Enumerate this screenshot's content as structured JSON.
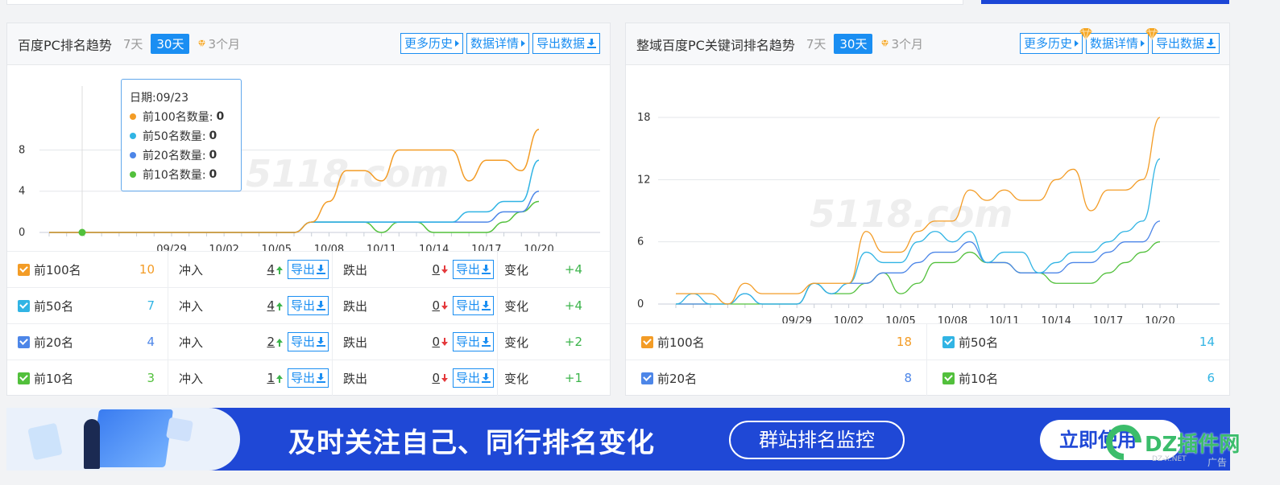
{
  "colors": {
    "accent": "#1a8ef2",
    "top100": "#f39c26",
    "top50": "#31b4e4",
    "top20": "#4d86e8",
    "top10": "#52c03c",
    "up": "#3cb44b",
    "down": "#e4393c"
  },
  "left_panel": {
    "title": "百度PC排名趋势",
    "ranges": [
      "7天",
      "30天",
      "3个月"
    ],
    "active_range": "30天",
    "buttons": {
      "history": "更多历史",
      "detail": "数据详情",
      "export": "导出数据"
    },
    "watermark": "5118.com",
    "tooltip": {
      "date": "日期:09/23",
      "rows": [
        {
          "label": "前100名数量:",
          "value": "0"
        },
        {
          "label": "前50名数量:",
          "value": "0"
        },
        {
          "label": "前20名数量:",
          "value": "0"
        },
        {
          "label": "前10名数量:",
          "value": "0"
        }
      ]
    },
    "stats": [
      {
        "label": "前100名",
        "count": "10",
        "in_label": "冲入",
        "in": "4",
        "export": "导出",
        "out_label": "跌出",
        "out": "0",
        "change_label": "变化",
        "change": "+4"
      },
      {
        "label": "前50名",
        "count": "7",
        "in_label": "冲入",
        "in": "4",
        "export": "导出",
        "out_label": "跌出",
        "out": "0",
        "change_label": "变化",
        "change": "+4"
      },
      {
        "label": "前20名",
        "count": "4",
        "in_label": "冲入",
        "in": "2",
        "export": "导出",
        "out_label": "跌出",
        "out": "0",
        "change_label": "变化",
        "change": "+2"
      },
      {
        "label": "前10名",
        "count": "3",
        "in_label": "冲入",
        "in": "1",
        "export": "导出",
        "out_label": "跌出",
        "out": "0",
        "change_label": "变化",
        "change": "+1"
      }
    ]
  },
  "right_panel": {
    "title": "整域百度PC关键词排名趋势",
    "ranges": [
      "7天",
      "30天",
      "3个月"
    ],
    "active_range": "30天",
    "buttons": {
      "history": "更多历史",
      "detail": "数据详情",
      "export": "导出数据"
    },
    "watermark": "5118.com",
    "stats": [
      {
        "label": "前100名",
        "count": "18"
      },
      {
        "label": "前50名",
        "count": "14"
      },
      {
        "label": "前20名",
        "count": "8"
      },
      {
        "label": "前10名",
        "count": "6"
      }
    ]
  },
  "banner": {
    "headline": "及时关注自己、同行排名变化",
    "pill": "群站排名监控",
    "cta": "立即使用",
    "ad_label": "广告"
  },
  "watermark_logo": {
    "text": "DZ插件网",
    "sub": "DZ-X.NET"
  },
  "chart_data": [
    {
      "type": "line",
      "x": [
        "09/23",
        "09/24",
        "09/25",
        "09/26",
        "09/27",
        "09/28",
        "09/29",
        "09/30",
        "10/01",
        "10/02",
        "10/03",
        "10/04",
        "10/05",
        "10/06",
        "10/07",
        "10/08",
        "10/09",
        "10/10",
        "10/11",
        "10/12",
        "10/13",
        "10/14",
        "10/15",
        "10/16",
        "10/17",
        "10/18",
        "10/19",
        "10/20"
      ],
      "xticks": [
        "09/29",
        "10/02",
        "10/05",
        "10/08",
        "10/11",
        "10/14",
        "10/17",
        "10/20"
      ],
      "yticks": [
        0,
        4,
        8
      ],
      "ylim": [
        0,
        11
      ],
      "series": [
        {
          "key": "top100",
          "values": [
            0,
            0,
            0,
            0,
            0,
            0,
            0,
            0,
            0,
            0,
            0,
            0,
            0,
            0,
            0,
            1,
            3,
            6,
            6,
            5,
            8,
            8,
            8,
            8,
            5,
            7,
            7,
            6,
            10
          ]
        },
        {
          "key": "top50",
          "values": [
            0,
            0,
            0,
            0,
            0,
            0,
            0,
            0,
            0,
            0,
            0,
            0,
            0,
            0,
            0,
            1,
            1,
            1,
            1,
            1,
            1,
            1,
            1,
            1,
            2,
            2,
            3,
            3,
            7
          ]
        },
        {
          "key": "top20",
          "values": [
            0,
            0,
            0,
            0,
            0,
            0,
            0,
            0,
            0,
            0,
            0,
            0,
            0,
            0,
            0,
            1,
            1,
            1,
            1,
            1,
            1,
            1,
            1,
            1,
            1,
            1,
            2,
            2,
            4
          ]
        },
        {
          "key": "top10",
          "values": [
            0,
            0,
            0,
            0,
            0,
            0,
            0,
            0,
            0,
            0,
            0,
            0,
            0,
            0,
            0,
            1,
            1,
            1,
            1,
            0,
            1,
            1,
            0,
            0,
            0,
            0,
            1,
            2,
            3
          ]
        }
      ],
      "grid": true
    },
    {
      "type": "line",
      "x": [
        "09/23",
        "09/24",
        "09/25",
        "09/26",
        "09/27",
        "09/28",
        "09/29",
        "09/30",
        "10/01",
        "10/02",
        "10/03",
        "10/04",
        "10/05",
        "10/06",
        "10/07",
        "10/08",
        "10/09",
        "10/10",
        "10/11",
        "10/12",
        "10/13",
        "10/14",
        "10/15",
        "10/16",
        "10/17",
        "10/18",
        "10/19",
        "10/20"
      ],
      "xticks": [
        "09/29",
        "10/02",
        "10/05",
        "10/08",
        "10/11",
        "10/14",
        "10/17",
        "10/20"
      ],
      "yticks": [
        0,
        6,
        12,
        18
      ],
      "ylim": [
        0,
        18
      ],
      "series": [
        {
          "key": "top100",
          "values": [
            1,
            1,
            1,
            0,
            2,
            1,
            1,
            1,
            2,
            2,
            2,
            7,
            5,
            5,
            7,
            8,
            8,
            11,
            10,
            11,
            10,
            10,
            12,
            13,
            9,
            11,
            11,
            12,
            18
          ]
        },
        {
          "key": "top50",
          "values": [
            0,
            1,
            0,
            0,
            1,
            0,
            0,
            0,
            2,
            1,
            2,
            5,
            4,
            4,
            6,
            7,
            6,
            7,
            4,
            5,
            5,
            3,
            4,
            5,
            5,
            6,
            7,
            8,
            14
          ]
        },
        {
          "key": "top20",
          "values": [
            0,
            0,
            0,
            0,
            1,
            0,
            0,
            0,
            2,
            1,
            2,
            2,
            3,
            3,
            4,
            5,
            5,
            6,
            4,
            4,
            3,
            3,
            3,
            4,
            4,
            5,
            6,
            6,
            8
          ]
        },
        {
          "key": "top10",
          "values": [
            0,
            0,
            0,
            0,
            0,
            0,
            0,
            0,
            2,
            1,
            1,
            2,
            3,
            1,
            2,
            4,
            4,
            5,
            4,
            4,
            3,
            3,
            2,
            2,
            2,
            3,
            4,
            5,
            6
          ]
        }
      ],
      "grid": true
    }
  ]
}
